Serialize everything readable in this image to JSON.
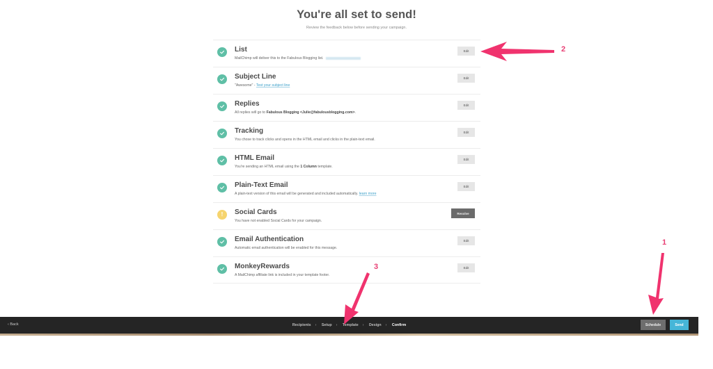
{
  "header": {
    "title": "You're all set to send!",
    "subtitle": "Review the feedback below before sending your campaign."
  },
  "checklist": [
    {
      "status": "ok",
      "title": "List",
      "desc": "MailChimp will deliver this to the Fabulous Blogging list.",
      "action": "Edit"
    },
    {
      "status": "ok",
      "title": "Subject Line",
      "desc_prefix": "\"Awesome\" - ",
      "link": "Test your subject line",
      "action": "Edit"
    },
    {
      "status": "ok",
      "title": "Replies",
      "desc_prefix": "All replies will go to ",
      "desc_bold": "Fabulous Blogging <Julie@fabulousblogging.com>",
      "desc_suffix": ".",
      "action": "Edit"
    },
    {
      "status": "ok",
      "title": "Tracking",
      "desc": "You chose to track clicks and opens in the HTML email and clicks in the plain-text email.",
      "action": "Edit"
    },
    {
      "status": "ok",
      "title": "HTML Email",
      "desc_prefix": "You're sending an HTML email using the ",
      "desc_bold": "1 Column",
      "desc_suffix": " template.",
      "action": "Edit"
    },
    {
      "status": "ok",
      "title": "Plain-Text Email",
      "desc_prefix": "A plain-text version of this email will be generated and included automatically. ",
      "link": "learn more",
      "action": "Edit"
    },
    {
      "status": "warning",
      "title": "Social Cards",
      "desc": "You have not enabled Social Cards for your campaign.",
      "action": "Resolve"
    },
    {
      "status": "ok",
      "title": "Email Authentication",
      "desc": "Automatic email authentication will be enabled for this message.",
      "action": "Edit"
    },
    {
      "status": "ok",
      "title": "MonkeyRewards",
      "desc": "A MailChimp affiliate link is included in your template footer.",
      "action": "Edit"
    }
  ],
  "footer": {
    "back_label": "Back",
    "steps": [
      "Recipients",
      "Setup",
      "Template",
      "Design",
      "Confirm"
    ],
    "current_step": "Confirm",
    "schedule_label": "Schedule",
    "send_label": "Send"
  },
  "annotations": {
    "marker_1": "1",
    "marker_2": "2",
    "marker_3": "3",
    "arrow_color": "#f0336e"
  },
  "colors": {
    "ok": "#5fbfa6",
    "warning": "#f6d46e",
    "send": "#46b6d8",
    "footer_bg": "#252525"
  }
}
